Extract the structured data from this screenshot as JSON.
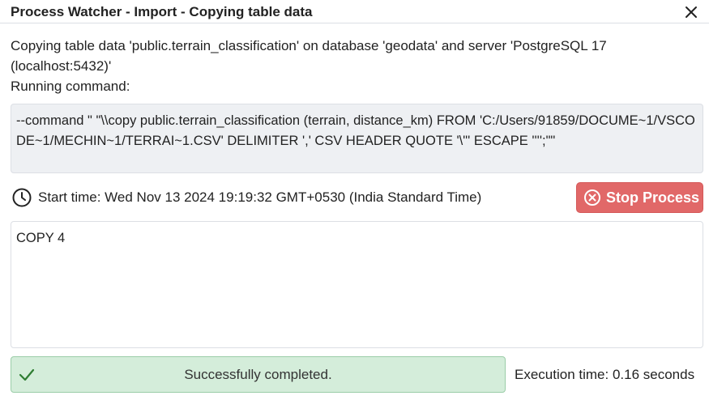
{
  "window": {
    "title": "Process Watcher - Import - Copying table data",
    "close_icon": "close-icon"
  },
  "description": {
    "line1": "Copying table data 'public.terrain_classification' on database 'geodata' and server 'PostgreSQL 17 (localhost:5432)'",
    "line2": "Running command:"
  },
  "command": {
    "text": "--command \" \"\\\\copy public.terrain_classification (terrain, distance_km) FROM 'C:/Users/91859/DOCUME~1/VSCODE~1/MECHIN~1/TERRAI~1.CSV' DELIMITER ',' CSV HEADER QUOTE '\\\"' ESCAPE '''';\"\""
  },
  "process": {
    "start_time": "Start time: Wed Nov 13 2024 19:19:32 GMT+0530 (India Standard Time)",
    "stop_label": "Stop Process",
    "clock_icon": "clock-icon",
    "stop_icon": "circle-x-icon"
  },
  "output": {
    "text": "COPY 4"
  },
  "status": {
    "message": "Successfully completed.",
    "icon": "check-icon",
    "color": "#d4edda",
    "execution_time": "Execution time: 0.16 seconds"
  },
  "colors": {
    "stop_button": "#e16868",
    "success_bg": "#d4edda",
    "success_border": "#9bcda8",
    "command_bg": "#eef0f3"
  }
}
